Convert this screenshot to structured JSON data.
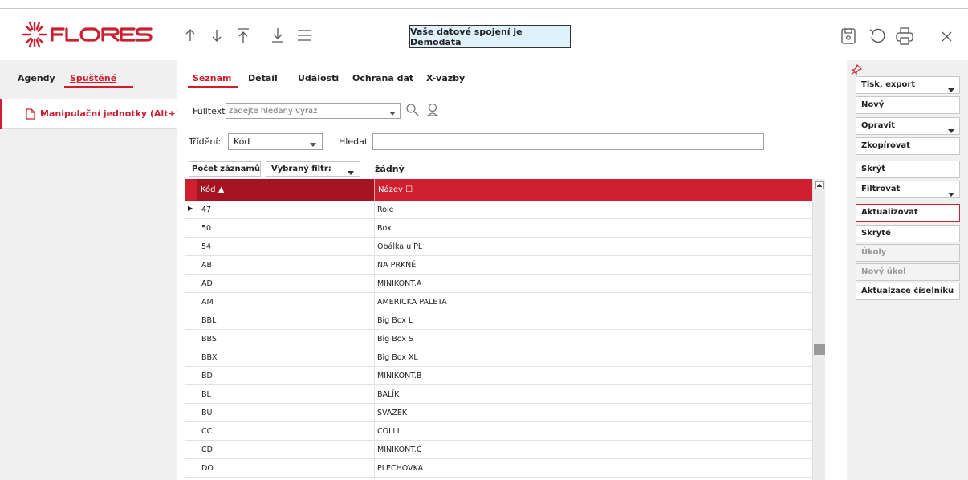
{
  "app": {
    "logo_text": "FLORES",
    "brand_color": "#cd1f2f"
  },
  "header": {
    "nav_icons": [
      "arrow-up-icon",
      "arrow-down-icon",
      "arrow-to-top-icon",
      "arrow-to-bottom-icon",
      "hamburger-menu-icon"
    ],
    "banner": "Vaše datové spojení je Demodata",
    "tool_icons": [
      "save-icon",
      "undo-icon",
      "print-icon",
      "close-icon"
    ]
  },
  "left_panel": {
    "tabs": [
      "Agendy",
      "Spuštěné"
    ],
    "active_tab": "Spuštěné",
    "item": {
      "label": "Manipulační jednotky (Alt+1)",
      "icon": "document-icon"
    }
  },
  "main": {
    "tabs": [
      "Seznam",
      "Detail",
      "Události",
      "Ochrana dat",
      "X-vazby"
    ],
    "active_tab": "Seznam",
    "fulltext": {
      "label": "Fulltext",
      "placeholder": "zadejte hledaný výraz",
      "value": ""
    },
    "sorting": {
      "label": "Třídění:",
      "value": "Kód"
    },
    "search": {
      "label": "Hledat",
      "value": ""
    },
    "count_button": "Počet záznamů",
    "filter": {
      "label": "Vybraný filtr:",
      "value": "žádný"
    },
    "grid": {
      "columns": [
        "Kód ▲",
        "Název ☐"
      ],
      "current_row_marker": "▶",
      "rows": [
        {
          "kod": "47",
          "nazev": "Role"
        },
        {
          "kod": "50",
          "nazev": "Box"
        },
        {
          "kod": "54",
          "nazev": "Obálka u PL"
        },
        {
          "kod": "AB",
          "nazev": "NA PRKNĚ"
        },
        {
          "kod": "AD",
          "nazev": "MINIKONT.A"
        },
        {
          "kod": "AM",
          "nazev": "AMERICKA PALETA"
        },
        {
          "kod": "BBL",
          "nazev": "Big Box L"
        },
        {
          "kod": "BBS",
          "nazev": "Big Box S"
        },
        {
          "kod": "BBX",
          "nazev": "Big Box XL"
        },
        {
          "kod": "BD",
          "nazev": "MINIKONT.B"
        },
        {
          "kod": "BL",
          "nazev": "BALÍK"
        },
        {
          "kod": "BU",
          "nazev": "SVAZEK"
        },
        {
          "kod": "CC",
          "nazev": "COLLI"
        },
        {
          "kod": "CD",
          "nazev": "MINIKONT.C"
        },
        {
          "kod": "DO",
          "nazev": "PLECHOVKA"
        }
      ]
    }
  },
  "right_panel": {
    "buttons": [
      {
        "label": "Tisk, export",
        "dropdown": true,
        "state": "normal"
      },
      {
        "label": "Nový",
        "dropdown": false,
        "state": "normal"
      },
      {
        "label": "Opravit",
        "dropdown": true,
        "state": "normal"
      },
      {
        "label": "Zkopírovat",
        "dropdown": false,
        "state": "normal"
      },
      {
        "label": "Skrýt",
        "dropdown": false,
        "state": "normal"
      },
      {
        "label": "Filtrovat",
        "dropdown": true,
        "state": "normal"
      },
      {
        "label": "Aktualizovat",
        "dropdown": false,
        "state": "active"
      },
      {
        "label": "Skryté",
        "dropdown": false,
        "state": "normal"
      },
      {
        "label": "Úkoly",
        "dropdown": false,
        "state": "disabled"
      },
      {
        "label": "Nový úkol",
        "dropdown": false,
        "state": "disabled"
      },
      {
        "label": "Aktualzace číselníku",
        "dropdown": false,
        "state": "normal"
      }
    ]
  }
}
